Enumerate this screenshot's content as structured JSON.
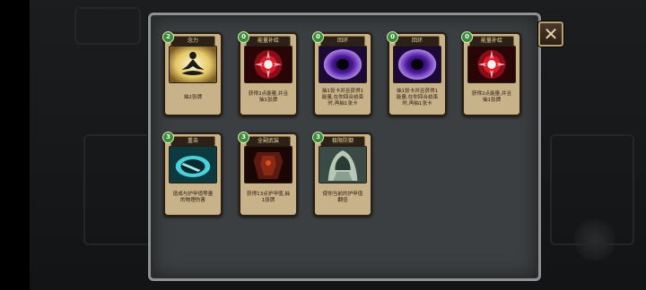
{
  "close_button": {
    "glyph": "✕",
    "icon": "close-icon"
  },
  "cards": [
    {
      "title": "念力",
      "cost": "2",
      "description": "抽2张牌",
      "art": "meditation-icon"
    },
    {
      "title": "能量补给",
      "cost": "0",
      "description": "获得2点能量,并且抽1张牌",
      "art": "energy-burst-icon"
    },
    {
      "title": "回环",
      "cost": "0",
      "description": "抽1张卡并且获得1能量,在你回合结束时,再抽1张卡",
      "art": "vortex-icon"
    },
    {
      "title": "回环",
      "cost": "0",
      "description": "抽1张卡并且获得1能量,在你回合结束时,再抽1张卡",
      "art": "vortex-icon"
    },
    {
      "title": "能量补给",
      "cost": "0",
      "description": "获得2点能量,并且抽1张牌",
      "art": "energy-burst-icon"
    },
    {
      "title": "重击",
      "cost": "3",
      "description": "造成与护甲值等量的物理伤害",
      "art": "shield-bash-icon"
    },
    {
      "title": "全副武装",
      "cost": "3",
      "description": "获得13点护甲值,抽1张牌",
      "art": "armor-icon"
    },
    {
      "title": "极限防御",
      "cost": "3",
      "description": "使你当前的护甲值翻倍",
      "art": "hooded-guard-icon"
    }
  ],
  "colors": {
    "card_bg": "#c8b28a",
    "cost_badge": "#3b8b3a",
    "panel_bg": "#3c3f41",
    "panel_border": "#8d9296"
  }
}
